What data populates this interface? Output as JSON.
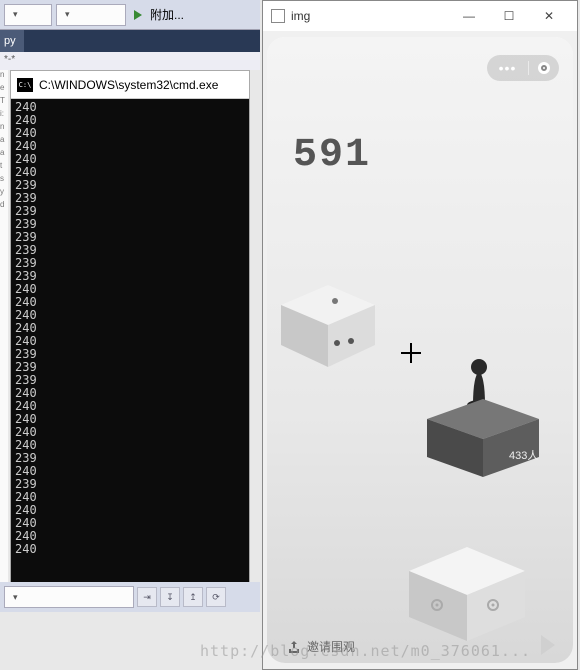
{
  "ide": {
    "attach_label": "附加...",
    "bottom_combo": " "
  },
  "tab": {
    "name": "py",
    "breadcrumb": "*-*"
  },
  "cmd": {
    "title": "C:\\WINDOWS\\system32\\cmd.exe",
    "lines": [
      "240",
      "240",
      "240",
      "240",
      "240",
      "240",
      "239",
      "239",
      "239",
      "239",
      "239",
      "239",
      "239",
      "239",
      "240",
      "240",
      "240",
      "240",
      "240",
      "239",
      "239",
      "239",
      "240",
      "240",
      "240",
      "240",
      "240",
      "239",
      "240",
      "239",
      "240",
      "240",
      "240",
      "240",
      "240"
    ]
  },
  "img_window": {
    "title": "img"
  },
  "game": {
    "score": "591",
    "platform_label": "433人",
    "invite_label": "邀请围观"
  },
  "watermark": "http://blog.csdn.net/m0_376061..."
}
